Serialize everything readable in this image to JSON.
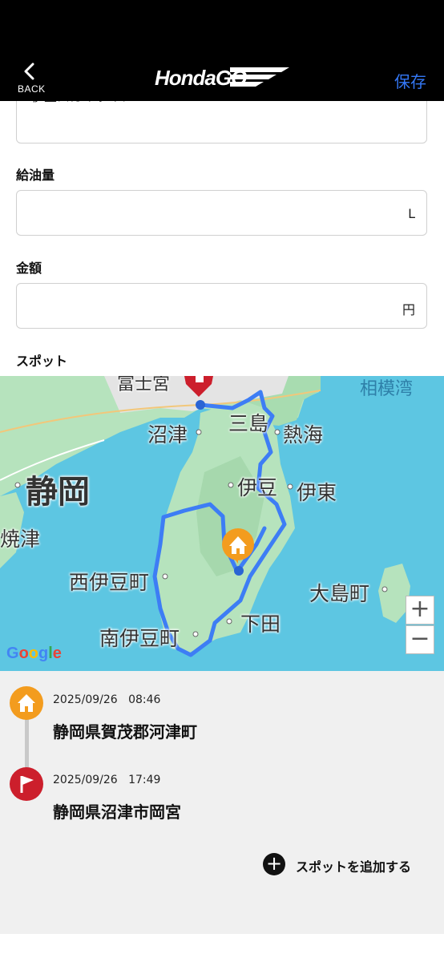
{
  "header": {
    "back_label": "BACK",
    "logo_text": "HondaGO",
    "save_label": "保存",
    "save_color": "#3478f6"
  },
  "form": {
    "route_name_value": "伊豆スカイライン",
    "fuel": {
      "label": "給油量",
      "value": "",
      "unit": "L"
    },
    "cost": {
      "label": "金額",
      "value": "",
      "unit": "円"
    },
    "spot_label": "スポット"
  },
  "map": {
    "places": {
      "fuji_partial": "富士宮",
      "sagami_bay": "相模湾",
      "numazu": "沼津",
      "mishima": "三島",
      "atami": "熱海",
      "shizuoka": "静岡",
      "izu": "伊豆",
      "ito": "伊東",
      "yaizu": "焼津",
      "nishiizu": "西伊豆町",
      "oshima": "大島町",
      "shimoda": "下田",
      "minamiizu": "南伊豆町"
    },
    "zoom_in": "+",
    "zoom_out": "−",
    "attribution": "Google",
    "route_color": "#3d7df5",
    "water_color": "#5dc6e2",
    "land_color": "#b6e3bd"
  },
  "spots": [
    {
      "icon": "home-icon",
      "color": "#f39c1e",
      "date": "2025/09/26",
      "time": "08:46",
      "place": "静岡県賀茂郡河津町"
    },
    {
      "icon": "flag-icon",
      "color": "#cc1f2c",
      "date": "2025/09/26",
      "time": "17:49",
      "place": "静岡県沼津市岡宮"
    }
  ],
  "add_spot_label": "スポットを追加する"
}
